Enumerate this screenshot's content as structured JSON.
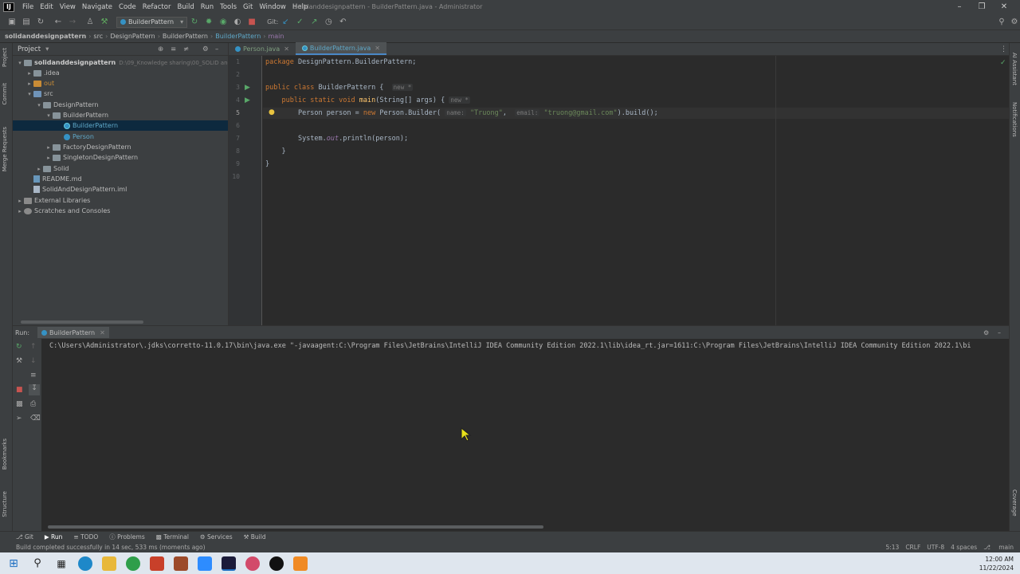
{
  "menubar": {
    "items": [
      "File",
      "Edit",
      "View",
      "Navigate",
      "Code",
      "Refactor",
      "Build",
      "Run",
      "Tools",
      "Git",
      "Window",
      "Help"
    ],
    "title": "solidanddesignpattern - BuilderPattern.java - Administrator"
  },
  "toolbar": {
    "run_config": "BuilderPattern",
    "git_label": "Git:"
  },
  "navbar": {
    "crumbs": [
      "solidanddesignpattern",
      "src",
      "DesignPattern",
      "BuilderPattern",
      "BuilderPattern",
      "main"
    ]
  },
  "project": {
    "header": "Project",
    "root_name": "solidanddesignpattern",
    "root_path": "D:\\09_Knowledge sharing\\00_SOLID and desi",
    "items": [
      ".idea",
      "out",
      "src",
      "DesignPattern",
      "BuilderPattern",
      "BuilderPattern",
      "Person",
      "FactoryDesignPattern",
      "SingletonDesignPattern",
      "Solid",
      "README.md",
      "SolidAndDesignPattern.iml",
      "External Libraries",
      "Scratches and Consoles"
    ]
  },
  "editor": {
    "tabs": [
      "Person.java",
      "BuilderPattern.java"
    ],
    "line_numbers": [
      "1",
      "2",
      "3",
      "4",
      "5",
      "6",
      "7",
      "8",
      "9",
      "10"
    ],
    "code": {
      "pkg_kw": "package",
      "pkg_name": " DesignPattern.BuilderPattern;",
      "class_kw": "public class",
      "class_name": " BuilderPattern {",
      "new_hint": "new *",
      "method_kw": "public static void",
      "method_name": "main",
      "method_params": "(String[] args) {",
      "l5_type": "Person",
      "l5_var": " person = ",
      "l5_new": "new",
      "l5_call": " Person.Builder(",
      "hint_name": "name:",
      "str_name": "\"Truong\"",
      "hint_email": "email:",
      "str_email": "\"truong@gmail.com\"",
      "l5_end": ").build();",
      "l7_start": "System.",
      "l7_out": "out",
      "l7_end": ".println(person);",
      "brace": "}"
    }
  },
  "run": {
    "label": "Run:",
    "tab": "BuilderPattern",
    "console_line": "C:\\Users\\Administrator\\.jdks\\corretto-11.0.17\\bin\\java.exe \"-javaagent:C:\\Program Files\\JetBrains\\IntelliJ IDEA Community Edition 2022.1\\lib\\idea_rt.jar=1611:C:\\Program Files\\JetBrains\\IntelliJ IDEA Community Edition 2022.1\\bi"
  },
  "bottom_tabs": [
    "Git",
    "Run",
    "TODO",
    "Problems",
    "Terminal",
    "Services",
    "Build"
  ],
  "sidebars": {
    "left": [
      "Project",
      "Commit",
      "Merge Requests",
      "Bookmarks",
      "Structure"
    ],
    "right": [
      "AI Assistant",
      "Notifications",
      "Coverage"
    ]
  },
  "status": {
    "message": "Build completed successfully in 14 sec, 533 ms (moments ago)",
    "position": "5:13",
    "line_sep": "CRLF",
    "encoding": "UTF-8",
    "indent": "4 spaces",
    "branch": "main"
  },
  "taskbar": {
    "time": "12:00 AM",
    "date": "11/22/2024"
  }
}
